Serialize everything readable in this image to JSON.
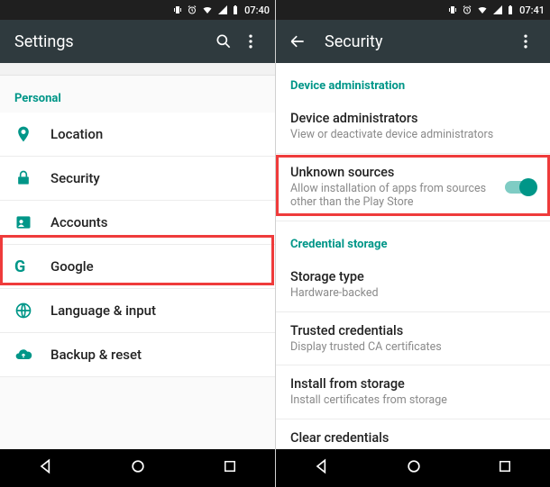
{
  "left": {
    "status": {
      "time": "07:40"
    },
    "appbar": {
      "title": "Settings"
    },
    "section_personal": "Personal",
    "items": [
      {
        "label": "Location"
      },
      {
        "label": "Security"
      },
      {
        "label": "Accounts"
      },
      {
        "label": "Google"
      },
      {
        "label": "Language & input"
      },
      {
        "label": "Backup & reset"
      }
    ]
  },
  "right": {
    "status": {
      "time": "07:41"
    },
    "appbar": {
      "title": "Security"
    },
    "sec_device_admin": "Device administration",
    "sec_credential": "Credential storage",
    "items": {
      "admins": {
        "title": "Device administrators",
        "sub": "View or deactivate device administrators"
      },
      "unknown": {
        "title": "Unknown sources",
        "sub": "Allow installation of apps from sources other than the Play Store"
      },
      "storage": {
        "title": "Storage type",
        "sub": "Hardware-backed"
      },
      "trusted": {
        "title": "Trusted credentials",
        "sub": "Display trusted CA certificates"
      },
      "install": {
        "title": "Install from storage",
        "sub": "Install certificates from storage"
      },
      "clear": {
        "title": "Clear credentials",
        "sub": ""
      }
    }
  }
}
